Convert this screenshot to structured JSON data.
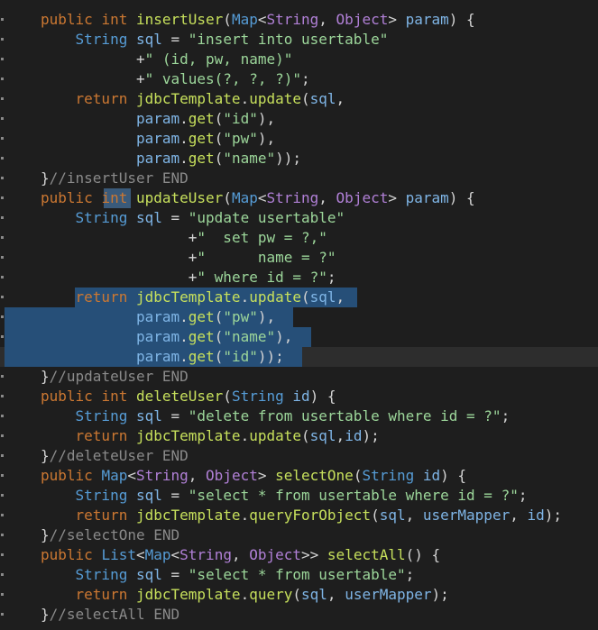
{
  "editor": {
    "lines": [
      [
        [
          "k",
          "public "
        ],
        [
          "k",
          "int "
        ],
        [
          "m",
          "insertUser"
        ],
        [
          "p",
          "("
        ],
        [
          "ty",
          "Map"
        ],
        [
          "p",
          "<"
        ],
        [
          "ty2",
          "String"
        ],
        [
          "p",
          ", "
        ],
        [
          "ty2",
          "Object"
        ],
        [
          "p",
          "> "
        ],
        [
          "v",
          "param"
        ],
        [
          "p",
          ") {"
        ]
      ],
      [
        [
          "t",
          "    "
        ],
        [
          "ty",
          "String "
        ],
        [
          "v",
          "sql"
        ],
        [
          "p",
          " = "
        ],
        [
          "s",
          "\"insert into usertable\""
        ]
      ],
      [
        [
          "t",
          "           "
        ],
        [
          "p",
          "+"
        ],
        [
          "s",
          "\" (id, pw, name)\""
        ]
      ],
      [
        [
          "t",
          "           "
        ],
        [
          "p",
          "+"
        ],
        [
          "s",
          "\" values(?, ?, ?)\""
        ],
        [
          "p",
          ";"
        ]
      ],
      [
        [
          "t",
          "    "
        ],
        [
          "k",
          "return "
        ],
        [
          "m",
          "jdbcTemplate"
        ],
        [
          "p",
          "."
        ],
        [
          "m",
          "update"
        ],
        [
          "p",
          "("
        ],
        [
          "v",
          "sql"
        ],
        [
          "p",
          ","
        ]
      ],
      [
        [
          "t",
          "           "
        ],
        [
          "v",
          "param"
        ],
        [
          "p",
          "."
        ],
        [
          "m",
          "get"
        ],
        [
          "p",
          "("
        ],
        [
          "s",
          "\"id\""
        ],
        [
          "p",
          "),"
        ]
      ],
      [
        [
          "t",
          "           "
        ],
        [
          "v",
          "param"
        ],
        [
          "p",
          "."
        ],
        [
          "m",
          "get"
        ],
        [
          "p",
          "("
        ],
        [
          "s",
          "\"pw\""
        ],
        [
          "p",
          "),"
        ]
      ],
      [
        [
          "t",
          "           "
        ],
        [
          "v",
          "param"
        ],
        [
          "p",
          "."
        ],
        [
          "m",
          "get"
        ],
        [
          "p",
          "("
        ],
        [
          "s",
          "\"name\""
        ],
        [
          "p",
          "));"
        ]
      ],
      [
        [
          "p",
          "}"
        ],
        [
          "c",
          "//insertUser END"
        ]
      ],
      [
        [
          "k",
          "public "
        ],
        [
          "k",
          "int "
        ],
        [
          "m",
          "updateUser"
        ],
        [
          "p",
          "("
        ],
        [
          "ty",
          "Map"
        ],
        [
          "p",
          "<"
        ],
        [
          "ty2",
          "String"
        ],
        [
          "p",
          ", "
        ],
        [
          "ty2",
          "Object"
        ],
        [
          "p",
          "> "
        ],
        [
          "v",
          "param"
        ],
        [
          "p",
          ") {"
        ]
      ],
      [
        [
          "t",
          "    "
        ],
        [
          "ty",
          "String "
        ],
        [
          "v",
          "sql"
        ],
        [
          "p",
          " = "
        ],
        [
          "s",
          "\"update usertable\""
        ]
      ],
      [
        [
          "t",
          "                 "
        ],
        [
          "p",
          "+"
        ],
        [
          "s",
          "\"  set pw = ?,\""
        ]
      ],
      [
        [
          "t",
          "                 "
        ],
        [
          "p",
          "+"
        ],
        [
          "s",
          "\"      name = ?\""
        ]
      ],
      [
        [
          "t",
          "                 "
        ],
        [
          "p",
          "+"
        ],
        [
          "s",
          "\" where id = ?\""
        ],
        [
          "p",
          ";"
        ]
      ],
      [
        [
          "t",
          "    "
        ],
        [
          "k",
          "return "
        ],
        [
          "m",
          "jdbcTemplate"
        ],
        [
          "p",
          "."
        ],
        [
          "m",
          "update"
        ],
        [
          "p",
          "("
        ],
        [
          "v",
          "sql"
        ],
        [
          "p",
          ","
        ]
      ],
      [
        [
          "t",
          "           "
        ],
        [
          "v",
          "param"
        ],
        [
          "p",
          "."
        ],
        [
          "m",
          "get"
        ],
        [
          "p",
          "("
        ],
        [
          "s",
          "\"pw\""
        ],
        [
          "p",
          "),"
        ]
      ],
      [
        [
          "t",
          "           "
        ],
        [
          "v",
          "param"
        ],
        [
          "p",
          "."
        ],
        [
          "m",
          "get"
        ],
        [
          "p",
          "("
        ],
        [
          "s",
          "\"name\""
        ],
        [
          "p",
          "),"
        ]
      ],
      [
        [
          "t",
          "           "
        ],
        [
          "v",
          "param"
        ],
        [
          "p",
          "."
        ],
        [
          "m",
          "get"
        ],
        [
          "p",
          "("
        ],
        [
          "s",
          "\"id\""
        ],
        [
          "p",
          "));"
        ]
      ],
      [
        [
          "p",
          "}"
        ],
        [
          "c",
          "//updateUser END"
        ]
      ],
      [
        [
          "k",
          "public "
        ],
        [
          "k",
          "int "
        ],
        [
          "m",
          "deleteUser"
        ],
        [
          "p",
          "("
        ],
        [
          "ty",
          "String "
        ],
        [
          "v",
          "id"
        ],
        [
          "p",
          ") {"
        ]
      ],
      [
        [
          "t",
          "    "
        ],
        [
          "ty",
          "String "
        ],
        [
          "v",
          "sql"
        ],
        [
          "p",
          " = "
        ],
        [
          "s",
          "\"delete from usertable where id = ?\""
        ],
        [
          "p",
          ";"
        ]
      ],
      [
        [
          "t",
          "    "
        ],
        [
          "k",
          "return "
        ],
        [
          "m",
          "jdbcTemplate"
        ],
        [
          "p",
          "."
        ],
        [
          "m",
          "update"
        ],
        [
          "p",
          "("
        ],
        [
          "v",
          "sql"
        ],
        [
          "p",
          ","
        ],
        [
          "v",
          "id"
        ],
        [
          "p",
          ");"
        ]
      ],
      [
        [
          "p",
          "}"
        ],
        [
          "c",
          "//deleteUser END"
        ]
      ],
      [
        [
          "k",
          "public "
        ],
        [
          "ty",
          "Map"
        ],
        [
          "p",
          "<"
        ],
        [
          "ty2",
          "String"
        ],
        [
          "p",
          ", "
        ],
        [
          "ty2",
          "Object"
        ],
        [
          "p",
          "> "
        ],
        [
          "m",
          "selectOne"
        ],
        [
          "p",
          "("
        ],
        [
          "ty",
          "String "
        ],
        [
          "v",
          "id"
        ],
        [
          "p",
          ") {"
        ]
      ],
      [
        [
          "t",
          "    "
        ],
        [
          "ty",
          "String "
        ],
        [
          "v",
          "sql"
        ],
        [
          "p",
          " = "
        ],
        [
          "s",
          "\"select * from usertable where id = ?\""
        ],
        [
          "p",
          ";"
        ]
      ],
      [
        [
          "t",
          "    "
        ],
        [
          "k",
          "return "
        ],
        [
          "m",
          "jdbcTemplate"
        ],
        [
          "p",
          "."
        ],
        [
          "m",
          "queryForObject"
        ],
        [
          "p",
          "("
        ],
        [
          "v",
          "sql"
        ],
        [
          "p",
          ", "
        ],
        [
          "v",
          "userMapper"
        ],
        [
          "p",
          ", "
        ],
        [
          "v",
          "id"
        ],
        [
          "p",
          ");"
        ]
      ],
      [
        [
          "p",
          "}"
        ],
        [
          "c",
          "//selectOne END"
        ]
      ],
      [
        [
          "k",
          "public "
        ],
        [
          "ty",
          "List"
        ],
        [
          "p",
          "<"
        ],
        [
          "ty",
          "Map"
        ],
        [
          "p",
          "<"
        ],
        [
          "ty2",
          "String"
        ],
        [
          "p",
          ", "
        ],
        [
          "ty2",
          "Object"
        ],
        [
          "p",
          ">> "
        ],
        [
          "m",
          "selectAll"
        ],
        [
          "p",
          "() {"
        ]
      ],
      [
        [
          "t",
          "    "
        ],
        [
          "ty",
          "String "
        ],
        [
          "v",
          "sql"
        ],
        [
          "p",
          " = "
        ],
        [
          "s",
          "\"select * from usertable\""
        ],
        [
          "p",
          ";"
        ]
      ],
      [
        [
          "t",
          "    "
        ],
        [
          "k",
          "return "
        ],
        [
          "m",
          "jdbcTemplate"
        ],
        [
          "p",
          "."
        ],
        [
          "m",
          "query"
        ],
        [
          "p",
          "("
        ],
        [
          "v",
          "sql"
        ],
        [
          "p",
          ", "
        ],
        [
          "v",
          "userMapper"
        ],
        [
          "p",
          ");"
        ]
      ],
      [
        [
          "p",
          "}"
        ],
        [
          "c",
          "//selectAll END"
        ]
      ]
    ]
  }
}
